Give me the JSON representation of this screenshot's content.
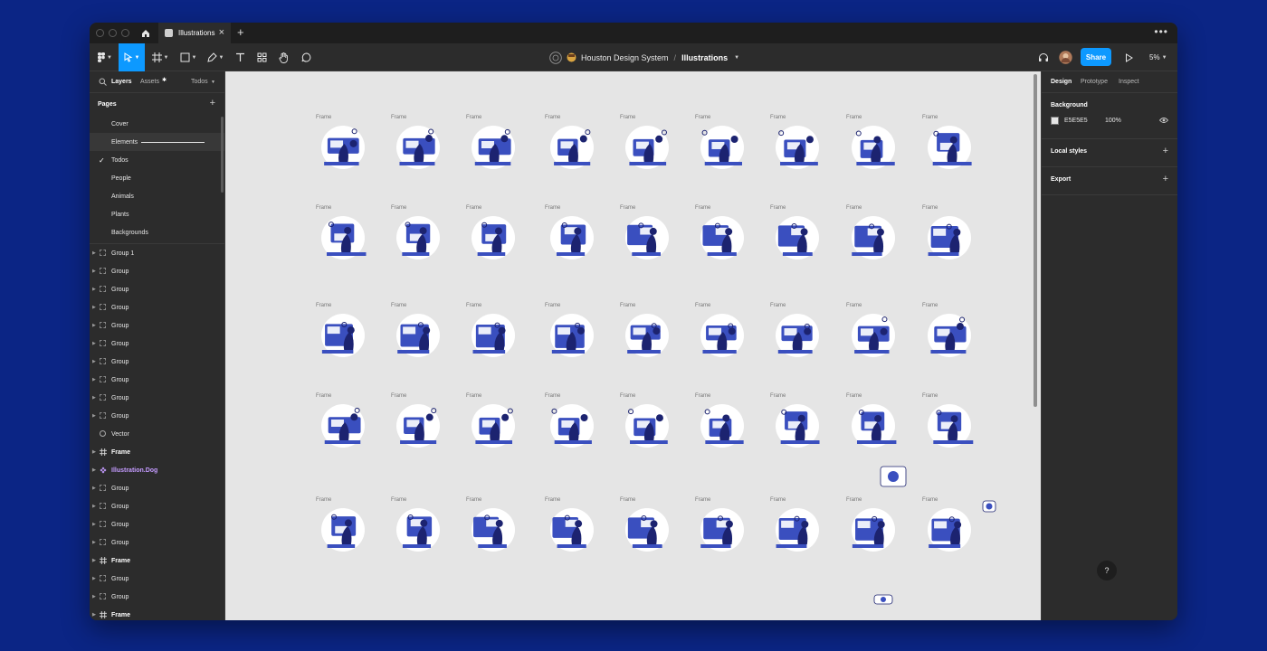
{
  "tab": {
    "title": "Illustrations"
  },
  "breadcrumb": {
    "team": "Houston Design System",
    "separator": "/",
    "file": "Illustrations"
  },
  "toolbar": {
    "share_label": "Share",
    "zoom": "5%"
  },
  "left_tabs": {
    "layers": "Layers",
    "assets": "Assets",
    "page_select": "Todos"
  },
  "pages": {
    "title": "Pages",
    "items": [
      "Cover",
      "Elements",
      "Todos",
      "People",
      "Animals",
      "Plants",
      "Backgrounds"
    ],
    "selected": "Todos"
  },
  "layers": [
    {
      "name": "Group 1",
      "kind": "group"
    },
    {
      "name": "Group",
      "kind": "group"
    },
    {
      "name": "Group",
      "kind": "group"
    },
    {
      "name": "Group",
      "kind": "group"
    },
    {
      "name": "Group",
      "kind": "group"
    },
    {
      "name": "Group",
      "kind": "group"
    },
    {
      "name": "Group",
      "kind": "group"
    },
    {
      "name": "Group",
      "kind": "group"
    },
    {
      "name": "Group",
      "kind": "group"
    },
    {
      "name": "Group",
      "kind": "group"
    },
    {
      "name": "Vector",
      "kind": "vector"
    },
    {
      "name": "Frame",
      "kind": "frame"
    },
    {
      "name": "Illustration.Dog",
      "kind": "component"
    },
    {
      "name": "Group",
      "kind": "group"
    },
    {
      "name": "Group",
      "kind": "group"
    },
    {
      "name": "Group",
      "kind": "group"
    },
    {
      "name": "Group",
      "kind": "group"
    },
    {
      "name": "Frame",
      "kind": "frame"
    },
    {
      "name": "Group",
      "kind": "group"
    },
    {
      "name": "Group",
      "kind": "group"
    },
    {
      "name": "Frame",
      "kind": "frame"
    }
  ],
  "canvas": {
    "frame_label": "Frame",
    "rows": 5,
    "cols": 9
  },
  "right_panel": {
    "tabs": [
      "Design",
      "Prototype",
      "Inspect"
    ],
    "background_title": "Background",
    "background_hex": "E5E5E5",
    "background_opacity": "100%",
    "local_styles": "Local styles",
    "export": "Export"
  },
  "help": "?",
  "colors": {
    "accent": "#0d99ff",
    "illustration_blue": "#3a4fbf",
    "illustration_navy": "#1c2370",
    "canvas": "#e5e5e5",
    "desktop": "#0b2585"
  }
}
